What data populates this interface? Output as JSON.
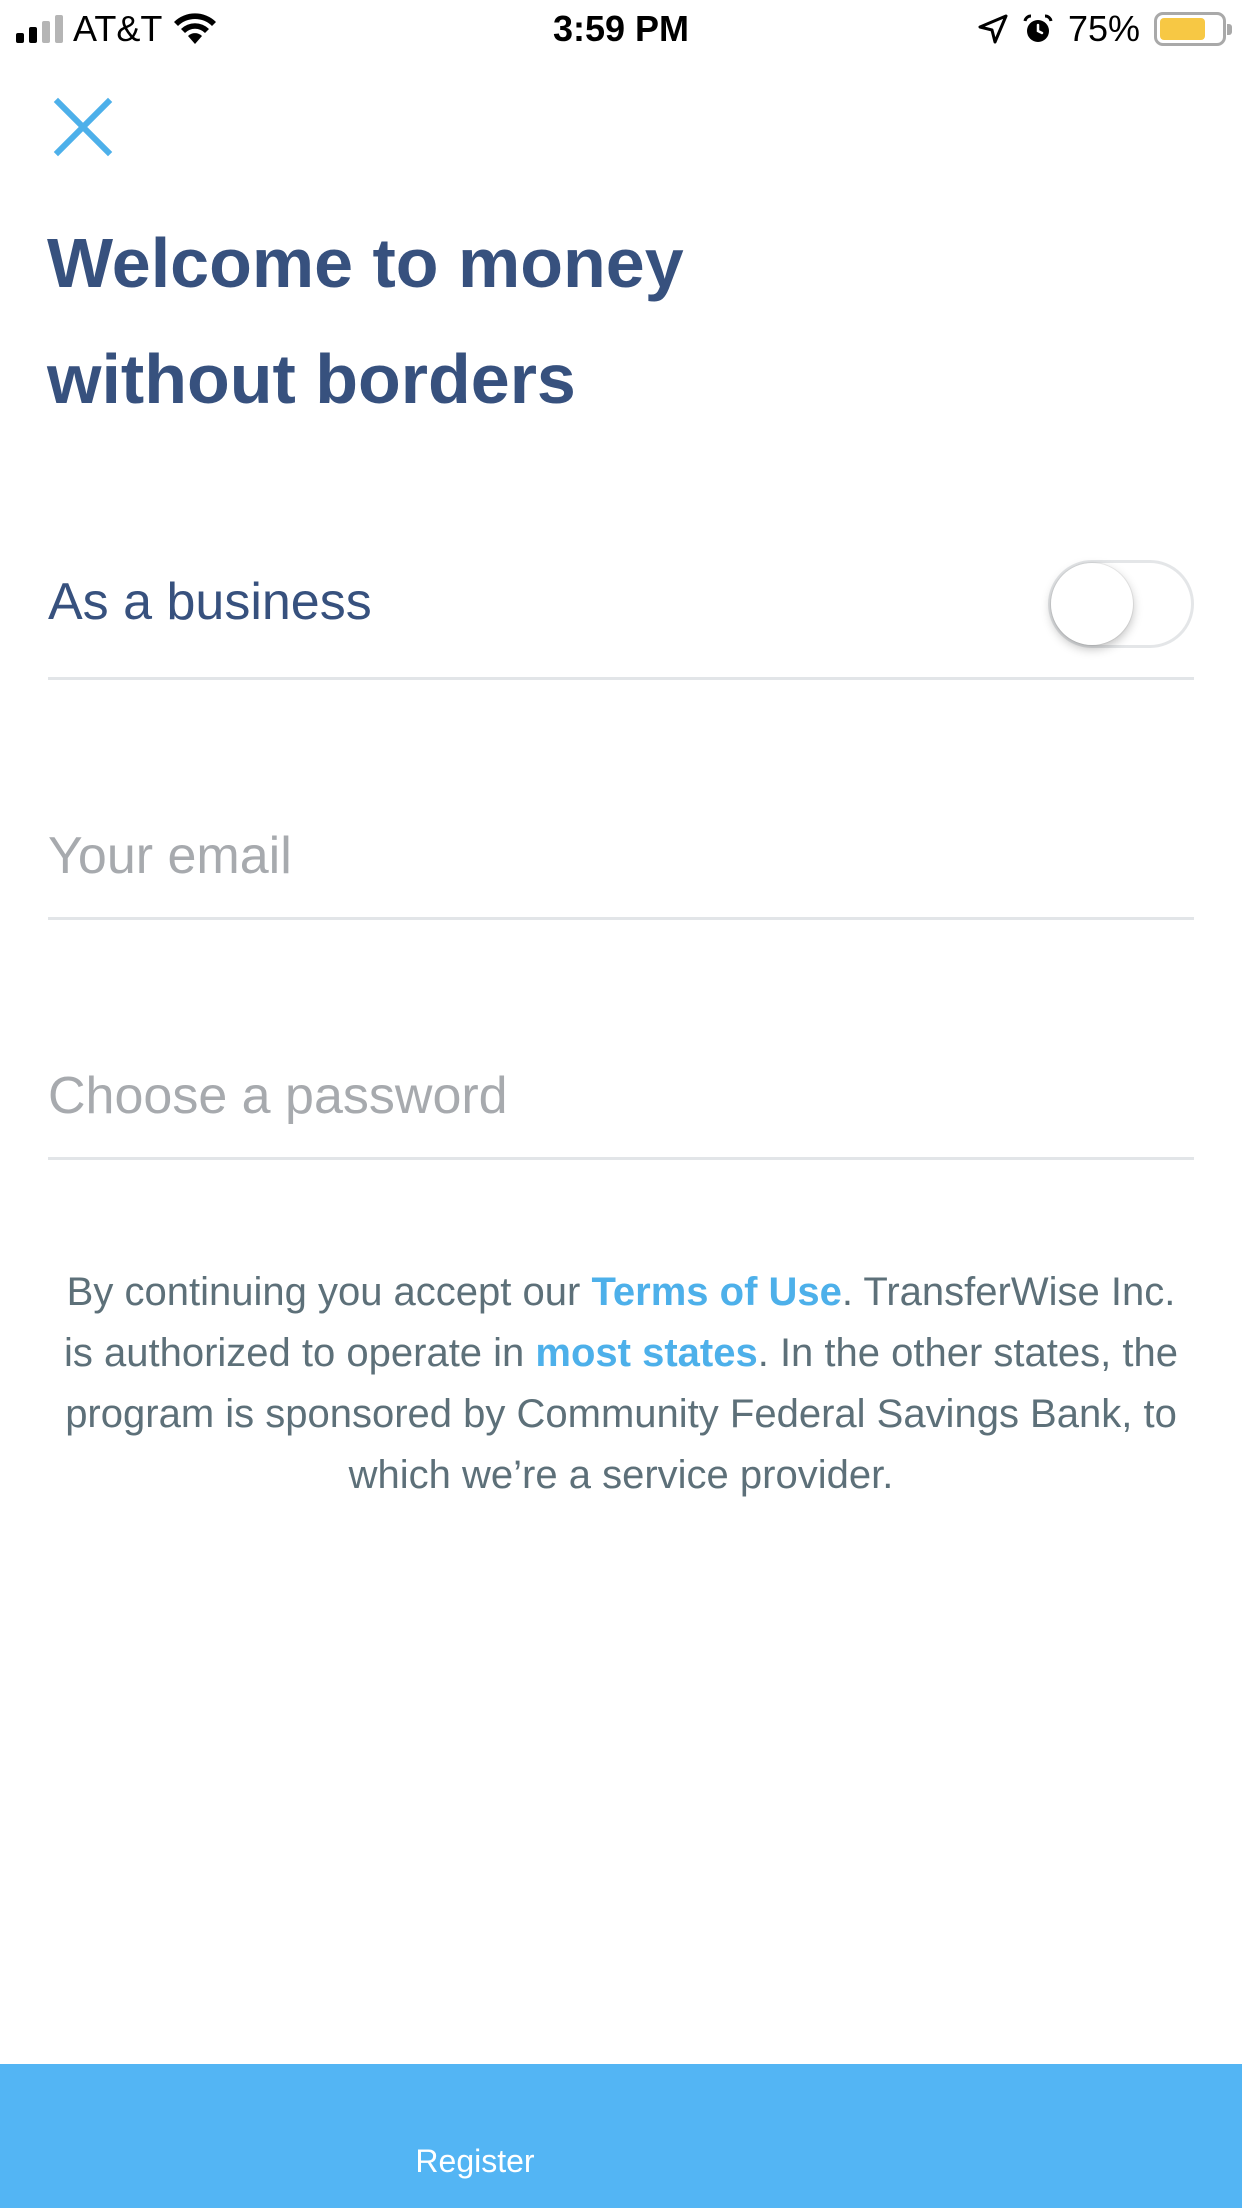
{
  "status_bar": {
    "carrier": "AT&T",
    "time": "3:59 PM",
    "battery_percent": "75%",
    "battery_level": 0.75,
    "battery_color": "#f7c844",
    "icons": [
      "signal-icon",
      "wifi-icon",
      "location-arrow-icon",
      "alarm-icon",
      "battery-icon"
    ]
  },
  "header": {
    "close_icon": "close-icon",
    "title_line1": "Welcome to money",
    "title_line2": "without borders"
  },
  "form": {
    "business_toggle_label": "As a business",
    "business_toggle_on": false,
    "email_placeholder": "Your email",
    "email_value": "",
    "password_placeholder": "Choose a password",
    "password_value": ""
  },
  "legal": {
    "part1": "By continuing you accept our ",
    "terms_link": "Terms of Use",
    "part2": ". TransferWise Inc. is authorized to operate in ",
    "states_link": "most states",
    "part3": ". In the other states, the program is sponsored by Community Federal Savings Bank, to which we’re a service provider."
  },
  "footer": {
    "register_label": "Register"
  },
  "colors": {
    "title": "#37517e",
    "accent_blue": "#4db0ea",
    "register_bg": "#53b5f4",
    "divider": "#e2e5e8",
    "placeholder": "#a7aaae"
  }
}
